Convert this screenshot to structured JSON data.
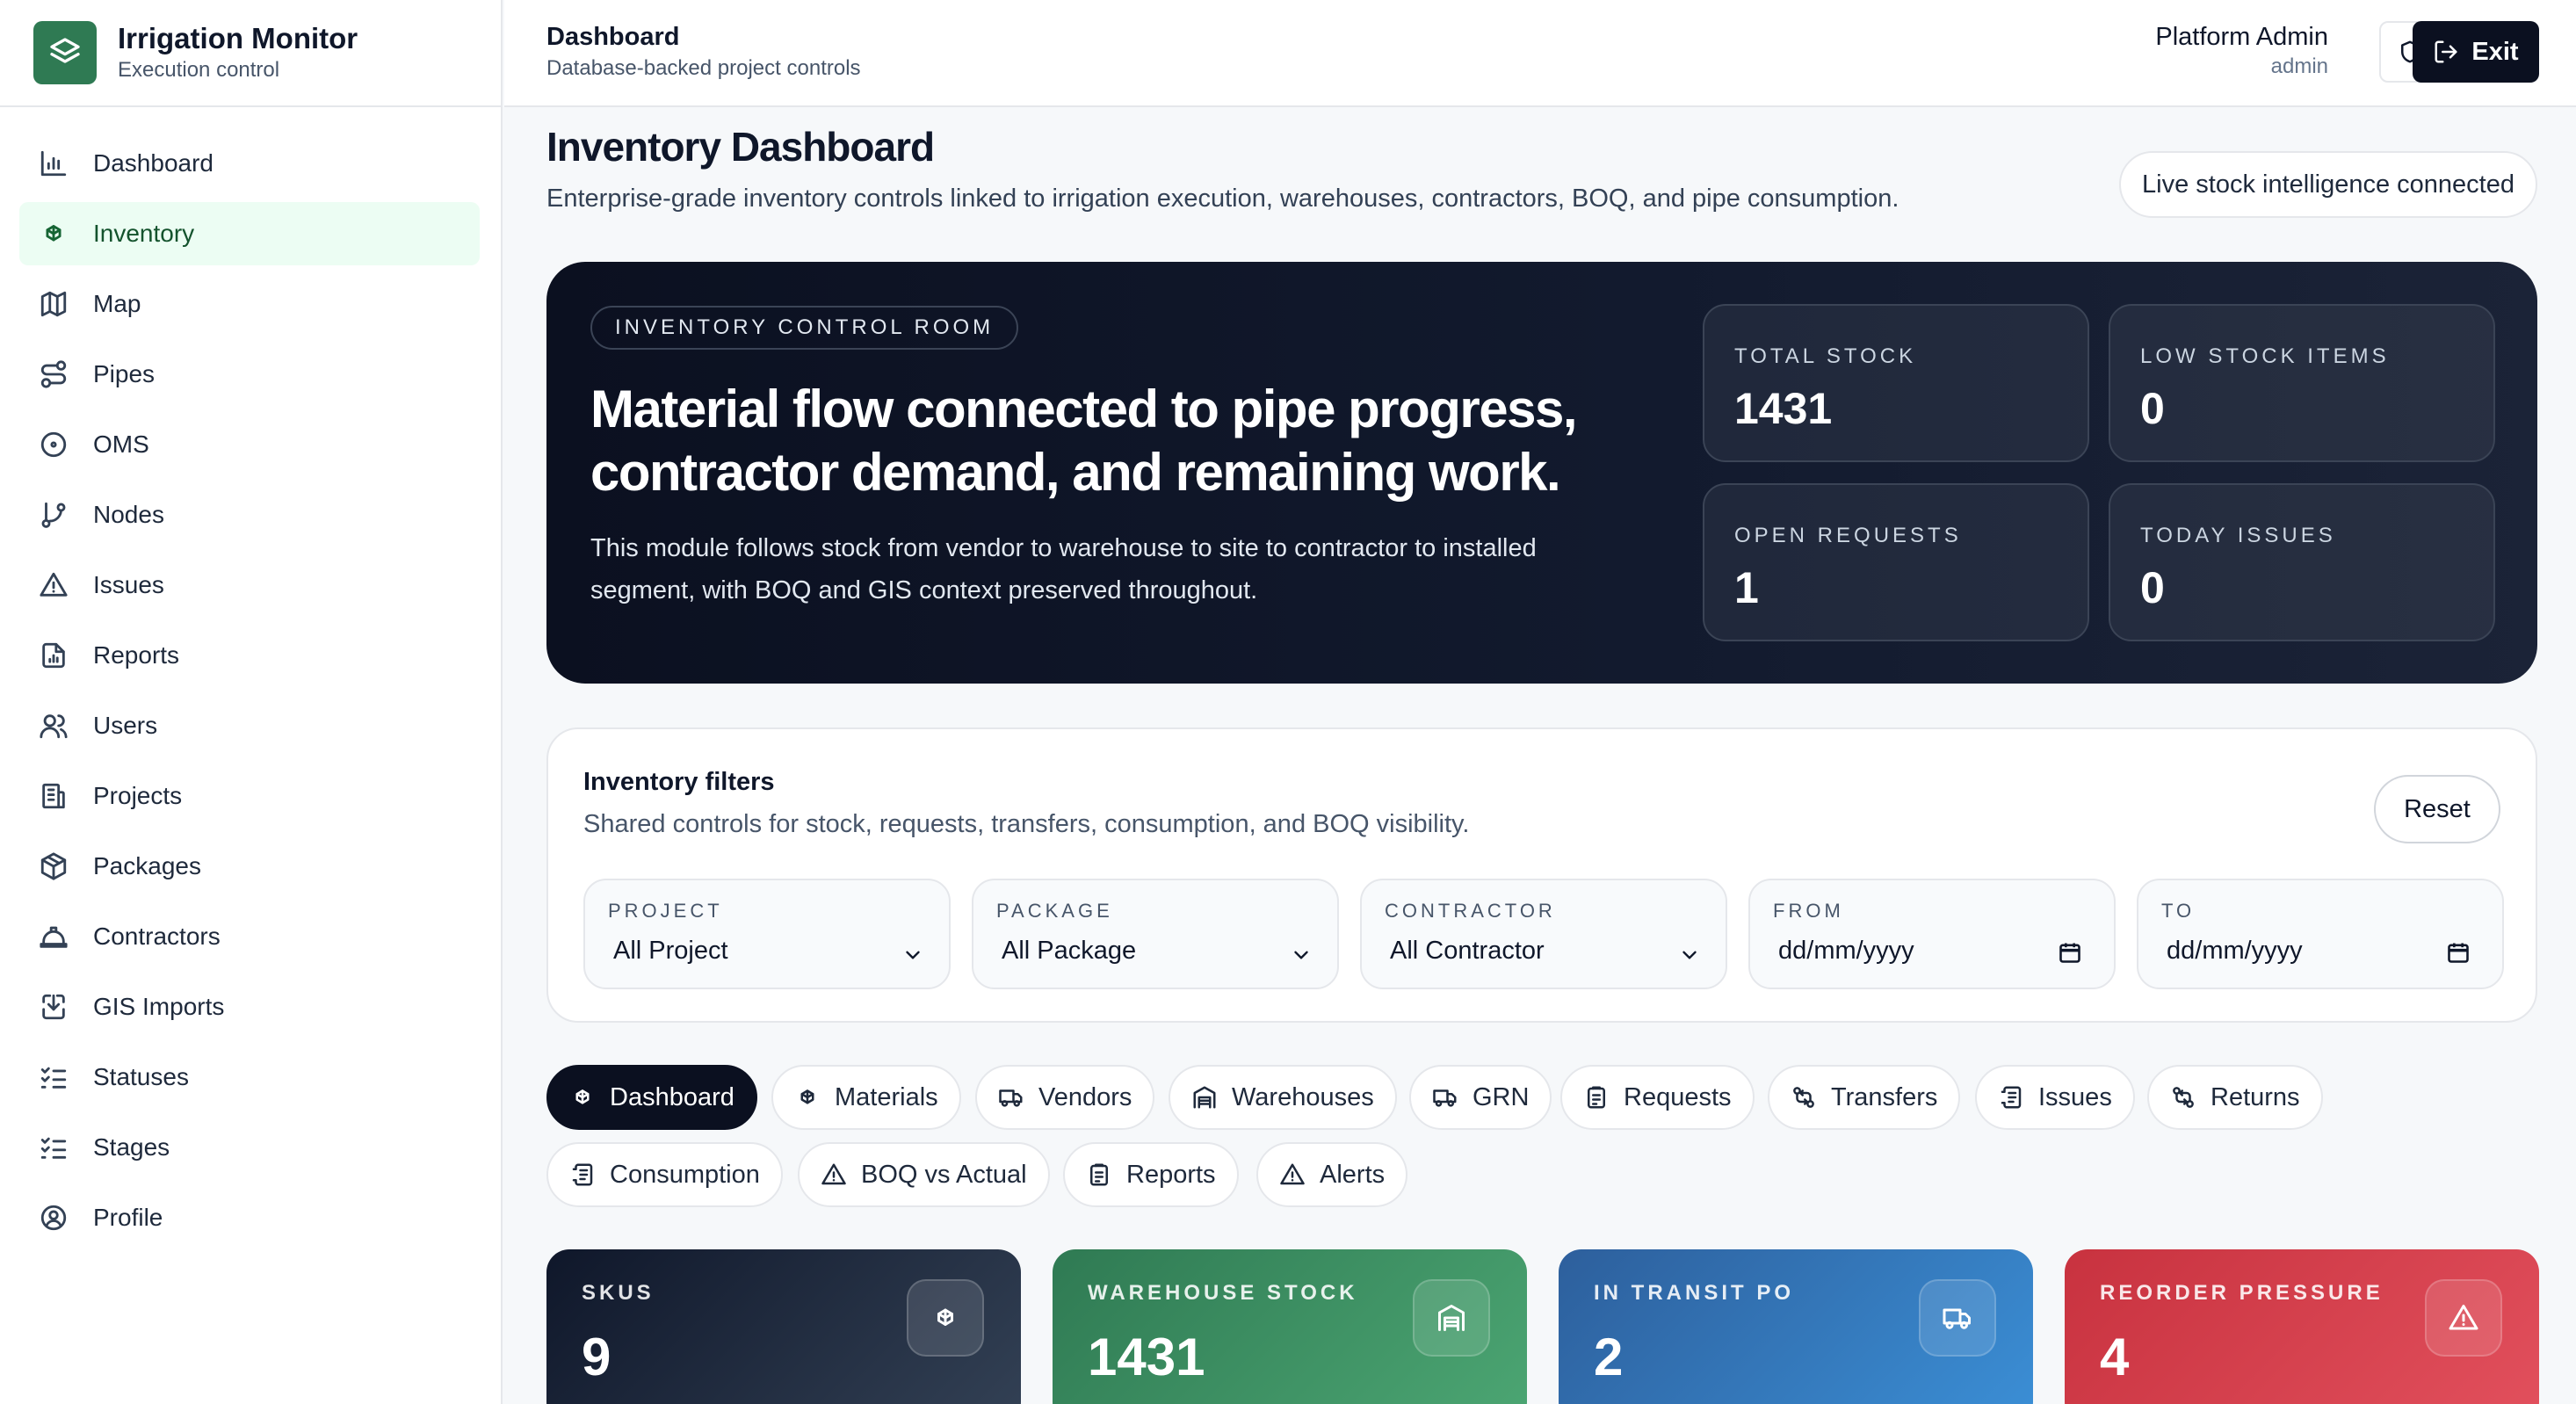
{
  "brand": {
    "title": "Irrigation Monitor",
    "subtitle": "Execution control"
  },
  "sidebar": {
    "items": [
      {
        "label": "Dashboard",
        "icon": "bar-chart-icon"
      },
      {
        "label": "Inventory",
        "icon": "boxes-icon",
        "active": true
      },
      {
        "label": "Map",
        "icon": "map-icon"
      },
      {
        "label": "Pipes",
        "icon": "route-icon"
      },
      {
        "label": "OMS",
        "icon": "target-icon"
      },
      {
        "label": "Nodes",
        "icon": "git-branch-icon"
      },
      {
        "label": "Issues",
        "icon": "alert-triangle-icon"
      },
      {
        "label": "Reports",
        "icon": "file-chart-icon"
      },
      {
        "label": "Users",
        "icon": "users-icon"
      },
      {
        "label": "Projects",
        "icon": "building-icon"
      },
      {
        "label": "Packages",
        "icon": "package-icon"
      },
      {
        "label": "Contractors",
        "icon": "hard-hat-icon"
      },
      {
        "label": "GIS Imports",
        "icon": "import-icon"
      },
      {
        "label": "Statuses",
        "icon": "list-checks-icon"
      },
      {
        "label": "Stages",
        "icon": "list-checks-icon"
      },
      {
        "label": "Profile",
        "icon": "user-circle-icon"
      }
    ]
  },
  "header": {
    "title": "Dashboard",
    "subtitle": "Database-backed project controls",
    "user_name": "Platform Admin",
    "user_role": "admin",
    "exit_label": "Exit"
  },
  "page": {
    "title": "Inventory Dashboard",
    "description": "Enterprise-grade inventory controls linked to irrigation execution, warehouses, contractors, BOQ, and pipe consumption.",
    "live_status": "Live stock intelligence connected"
  },
  "hero": {
    "tag": "INVENTORY CONTROL ROOM",
    "headline": "Material flow connected to pipe progress, contractor demand, and remaining work.",
    "body": "This module follows stock from vendor to warehouse to site to contractor to installed segment, with BOQ and GIS context preserved throughout.",
    "kpis": [
      {
        "label": "TOTAL STOCK",
        "value": "1431"
      },
      {
        "label": "LOW STOCK ITEMS",
        "value": "0"
      },
      {
        "label": "OPEN REQUESTS",
        "value": "1"
      },
      {
        "label": "TODAY ISSUES",
        "value": "0"
      }
    ]
  },
  "filters": {
    "title": "Inventory filters",
    "subtitle": "Shared controls for stock, requests, transfers, consumption, and BOQ visibility.",
    "reset_label": "Reset",
    "fields": [
      {
        "label": "PROJECT",
        "value": "All Project",
        "type": "select"
      },
      {
        "label": "PACKAGE",
        "value": "All Package",
        "type": "select"
      },
      {
        "label": "CONTRACTOR",
        "value": "All Contractor",
        "type": "select"
      },
      {
        "label": "FROM",
        "value": "dd/mm/yyyy",
        "type": "date"
      },
      {
        "label": "TO",
        "value": "dd/mm/yyyy",
        "type": "date"
      }
    ]
  },
  "tabs": [
    {
      "label": "Dashboard",
      "icon": "boxes-icon",
      "active": true
    },
    {
      "label": "Materials",
      "icon": "boxes-icon"
    },
    {
      "label": "Vendors",
      "icon": "truck-icon"
    },
    {
      "label": "Warehouses",
      "icon": "warehouse-icon"
    },
    {
      "label": "GRN",
      "icon": "truck-icon"
    },
    {
      "label": "Requests",
      "icon": "clipboard-icon"
    },
    {
      "label": "Transfers",
      "icon": "transfer-icon"
    },
    {
      "label": "Issues",
      "icon": "scroll-icon"
    },
    {
      "label": "Returns",
      "icon": "transfer-icon"
    },
    {
      "label": "Consumption",
      "icon": "scroll-icon"
    },
    {
      "label": "BOQ vs Actual",
      "icon": "alert-triangle-icon"
    },
    {
      "label": "Reports",
      "icon": "clipboard-icon"
    },
    {
      "label": "Alerts",
      "icon": "alert-triangle-icon"
    }
  ],
  "stats": [
    {
      "label": "SKUS",
      "value": "9",
      "icon": "boxes-icon",
      "color_from": "#0f172a",
      "color_to": "#334155"
    },
    {
      "label": "WAREHOUSE STOCK",
      "value": "1431",
      "icon": "warehouse-icon",
      "color_from": "#2f7a53",
      "color_to": "#4ca673"
    },
    {
      "label": "IN TRANSIT PO",
      "value": "2",
      "icon": "truck-icon",
      "color_from": "#2d5f9c",
      "color_to": "#3b8fd6"
    },
    {
      "label": "REORDER PRESSURE",
      "value": "4",
      "icon": "alert-triangle-icon",
      "color_from": "#c8323f",
      "color_to": "#e2505d"
    }
  ]
}
